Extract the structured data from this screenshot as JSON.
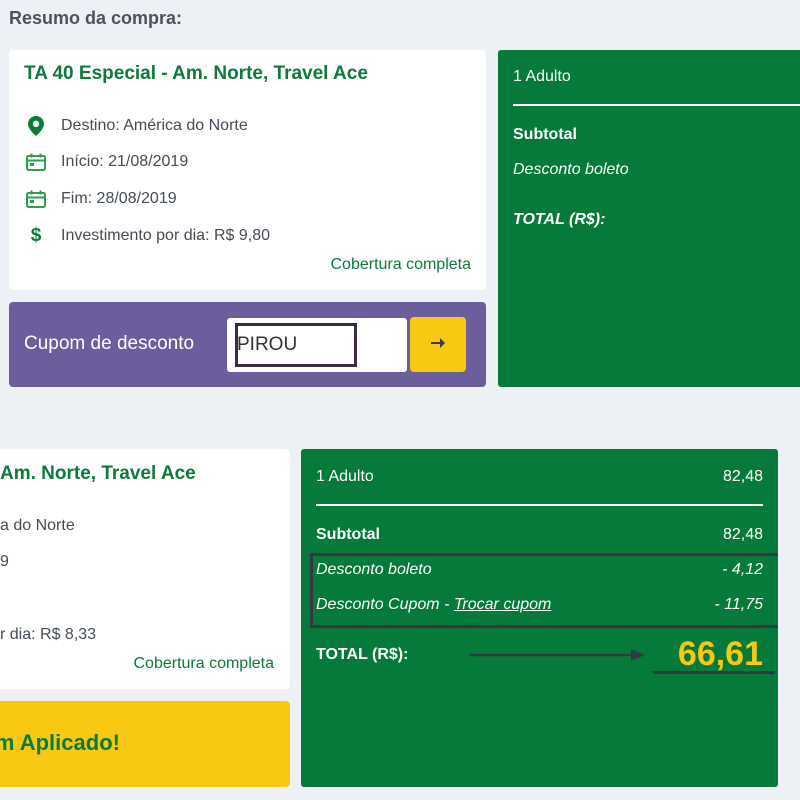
{
  "page": {
    "title": "Resumo da compra:"
  },
  "before": {
    "product": {
      "title": "TA 40 Especial - Am. Norte, Travel Ace",
      "destination": "Destino: América do Norte",
      "start": "Início: 21/08/2019",
      "end": "Fim: 28/08/2019",
      "daily_cost": "Investimento por dia: R$ 9,80",
      "coverage_link": "Cobertura completa"
    },
    "coupon": {
      "label": "Cupom de desconto",
      "value": "PIROU",
      "submit_icon": "arrow-right-icon"
    },
    "summary": {
      "travelers": "1 Adulto",
      "subtotal_label": "Subtotal",
      "boleto_discount_label": "Desconto boleto",
      "total_label": "TOTAL (R$):"
    }
  },
  "after": {
    "product": {
      "title_visible": "Am. Norte, Travel Ace",
      "destination_visible": "a do Norte",
      "start_visible": "9",
      "daily_cost_visible": "r dia: R$ 8,33",
      "coverage_link": "Cobertura completa"
    },
    "coupon_applied": {
      "text_visible": "pom Aplicado!"
    },
    "summary": {
      "travelers": "1 Adulto",
      "travelers_value": "82,48",
      "subtotal_label": "Subtotal",
      "subtotal_value": "82,48",
      "boleto_discount_label": "Desconto boleto",
      "boleto_discount_value": "- 4,12",
      "coupon_discount_label": "Desconto Cupom - ",
      "swap_coupon_link": "Trocar cupom",
      "coupon_discount_value": "- 11,75",
      "total_label": "TOTAL (R$):",
      "total_value": "66,61"
    }
  },
  "icons": {
    "destination": "map-pin-icon",
    "start": "calendar-icon",
    "end": "calendar-icon",
    "daily_cost": "dollar-icon"
  },
  "colors": {
    "brand_green": "#057a3a",
    "text_green": "#0b7a3b",
    "accent_yellow": "#f8c813",
    "coupon_purple": "#6c5e9c",
    "page_bg": "#edf0f5"
  }
}
